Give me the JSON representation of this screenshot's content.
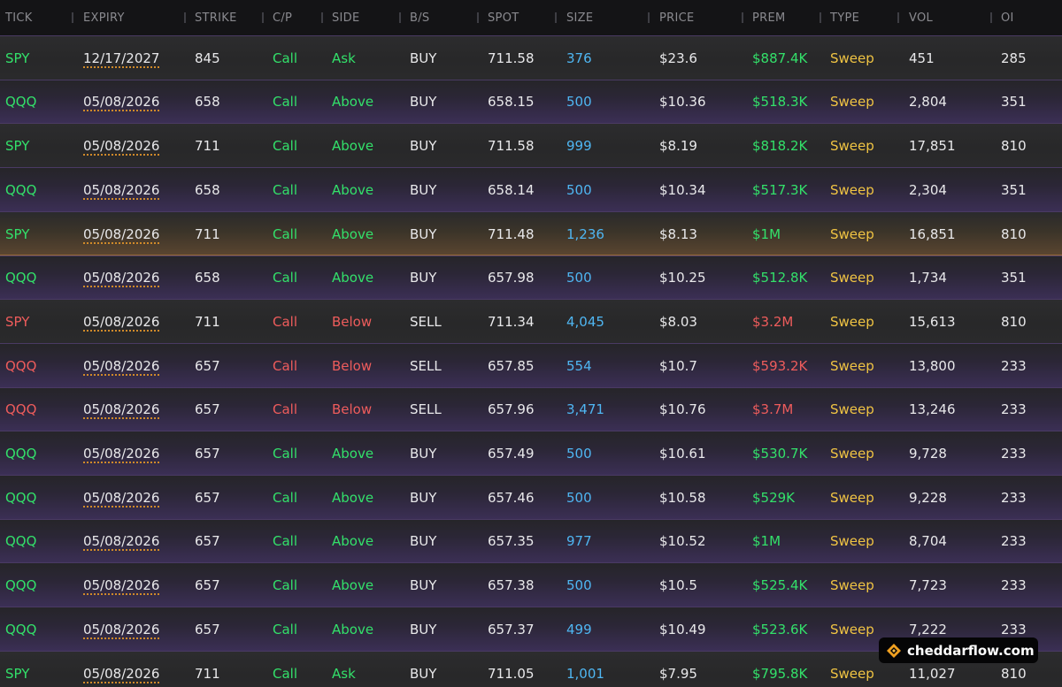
{
  "columns": [
    {
      "key": "tick",
      "label": "TICK"
    },
    {
      "key": "expiry",
      "label": "EXPIRY"
    },
    {
      "key": "strike",
      "label": "STRIKE"
    },
    {
      "key": "cp",
      "label": "C/P"
    },
    {
      "key": "side",
      "label": "SIDE"
    },
    {
      "key": "bs",
      "label": "B/S"
    },
    {
      "key": "spot",
      "label": "SPOT"
    },
    {
      "key": "size",
      "label": "SIZE"
    },
    {
      "key": "price",
      "label": "PRICE"
    },
    {
      "key": "prem",
      "label": "PREM"
    },
    {
      "key": "type",
      "label": "TYPE"
    },
    {
      "key": "vol",
      "label": "VOL"
    },
    {
      "key": "oi",
      "label": "OI"
    }
  ],
  "rows": [
    {
      "tick": "SPY",
      "expiry": "12/17/2027",
      "strike": "845",
      "cp": "Call",
      "side": "Ask",
      "bs": "BUY",
      "spot": "711.58",
      "size": "376",
      "price": "$23.6",
      "prem": "$887.4K",
      "type": "Sweep",
      "vol": "451",
      "oi": "285",
      "sentiment": "bullish",
      "bg": "gray"
    },
    {
      "tick": "QQQ",
      "expiry": "05/08/2026",
      "strike": "658",
      "cp": "Call",
      "side": "Above",
      "bs": "BUY",
      "spot": "658.15",
      "size": "500",
      "price": "$10.36",
      "prem": "$518.3K",
      "type": "Sweep",
      "vol": "2,804",
      "oi": "351",
      "sentiment": "bullish",
      "bg": "purple"
    },
    {
      "tick": "SPY",
      "expiry": "05/08/2026",
      "strike": "711",
      "cp": "Call",
      "side": "Above",
      "bs": "BUY",
      "spot": "711.58",
      "size": "999",
      "price": "$8.19",
      "prem": "$818.2K",
      "type": "Sweep",
      "vol": "17,851",
      "oi": "810",
      "sentiment": "bullish",
      "bg": "gray"
    },
    {
      "tick": "QQQ",
      "expiry": "05/08/2026",
      "strike": "658",
      "cp": "Call",
      "side": "Above",
      "bs": "BUY",
      "spot": "658.14",
      "size": "500",
      "price": "$10.34",
      "prem": "$517.3K",
      "type": "Sweep",
      "vol": "2,304",
      "oi": "351",
      "sentiment": "bullish",
      "bg": "purple"
    },
    {
      "tick": "SPY",
      "expiry": "05/08/2026",
      "strike": "711",
      "cp": "Call",
      "side": "Above",
      "bs": "BUY",
      "spot": "711.48",
      "size": "1,236",
      "price": "$8.13",
      "prem": "$1M",
      "type": "Sweep",
      "vol": "16,851",
      "oi": "810",
      "sentiment": "bullish",
      "bg": "amber"
    },
    {
      "tick": "QQQ",
      "expiry": "05/08/2026",
      "strike": "658",
      "cp": "Call",
      "side": "Above",
      "bs": "BUY",
      "spot": "657.98",
      "size": "500",
      "price": "$10.25",
      "prem": "$512.8K",
      "type": "Sweep",
      "vol": "1,734",
      "oi": "351",
      "sentiment": "bullish",
      "bg": "purple"
    },
    {
      "tick": "SPY",
      "expiry": "05/08/2026",
      "strike": "711",
      "cp": "Call",
      "side": "Below",
      "bs": "SELL",
      "spot": "711.34",
      "size": "4,045",
      "price": "$8.03",
      "prem": "$3.2M",
      "type": "Sweep",
      "vol": "15,613",
      "oi": "810",
      "sentiment": "bearish",
      "bg": "gray"
    },
    {
      "tick": "QQQ",
      "expiry": "05/08/2026",
      "strike": "657",
      "cp": "Call",
      "side": "Below",
      "bs": "SELL",
      "spot": "657.85",
      "size": "554",
      "price": "$10.7",
      "prem": "$593.2K",
      "type": "Sweep",
      "vol": "13,800",
      "oi": "233",
      "sentiment": "bearish",
      "bg": "purple"
    },
    {
      "tick": "QQQ",
      "expiry": "05/08/2026",
      "strike": "657",
      "cp": "Call",
      "side": "Below",
      "bs": "SELL",
      "spot": "657.96",
      "size": "3,471",
      "price": "$10.76",
      "prem": "$3.7M",
      "type": "Sweep",
      "vol": "13,246",
      "oi": "233",
      "sentiment": "bearish",
      "bg": "purple"
    },
    {
      "tick": "QQQ",
      "expiry": "05/08/2026",
      "strike": "657",
      "cp": "Call",
      "side": "Above",
      "bs": "BUY",
      "spot": "657.49",
      "size": "500",
      "price": "$10.61",
      "prem": "$530.7K",
      "type": "Sweep",
      "vol": "9,728",
      "oi": "233",
      "sentiment": "bullish",
      "bg": "purple"
    },
    {
      "tick": "QQQ",
      "expiry": "05/08/2026",
      "strike": "657",
      "cp": "Call",
      "side": "Above",
      "bs": "BUY",
      "spot": "657.46",
      "size": "500",
      "price": "$10.58",
      "prem": "$529K",
      "type": "Sweep",
      "vol": "9,228",
      "oi": "233",
      "sentiment": "bullish",
      "bg": "purple"
    },
    {
      "tick": "QQQ",
      "expiry": "05/08/2026",
      "strike": "657",
      "cp": "Call",
      "side": "Above",
      "bs": "BUY",
      "spot": "657.35",
      "size": "977",
      "price": "$10.52",
      "prem": "$1M",
      "type": "Sweep",
      "vol": "8,704",
      "oi": "233",
      "sentiment": "bullish",
      "bg": "purple"
    },
    {
      "tick": "QQQ",
      "expiry": "05/08/2026",
      "strike": "657",
      "cp": "Call",
      "side": "Above",
      "bs": "BUY",
      "spot": "657.38",
      "size": "500",
      "price": "$10.5",
      "prem": "$525.4K",
      "type": "Sweep",
      "vol": "7,723",
      "oi": "233",
      "sentiment": "bullish",
      "bg": "purple"
    },
    {
      "tick": "QQQ",
      "expiry": "05/08/2026",
      "strike": "657",
      "cp": "Call",
      "side": "Above",
      "bs": "BUY",
      "spot": "657.37",
      "size": "499",
      "price": "$10.49",
      "prem": "$523.6K",
      "type": "Sweep",
      "vol": "7,222",
      "oi": "233",
      "sentiment": "bullish",
      "bg": "purple"
    },
    {
      "tick": "SPY",
      "expiry": "05/08/2026",
      "strike": "711",
      "cp": "Call",
      "side": "Ask",
      "bs": "BUY",
      "spot": "711.05",
      "size": "1,001",
      "price": "$7.95",
      "prem": "$795.8K",
      "type": "Sweep",
      "vol": "11,027",
      "oi": "810",
      "sentiment": "bullish",
      "bg": "gray"
    }
  ],
  "watermark": {
    "text": "cheddarflow.com",
    "icon": "cheddar-logo-icon"
  },
  "colors": {
    "bullish": "#33e06a",
    "bearish": "#ee5c5c",
    "size": "#4fb6f2",
    "type": "#f0c443",
    "header_text": "#8a8a8f",
    "expiry_underline": "#d08a2a"
  }
}
